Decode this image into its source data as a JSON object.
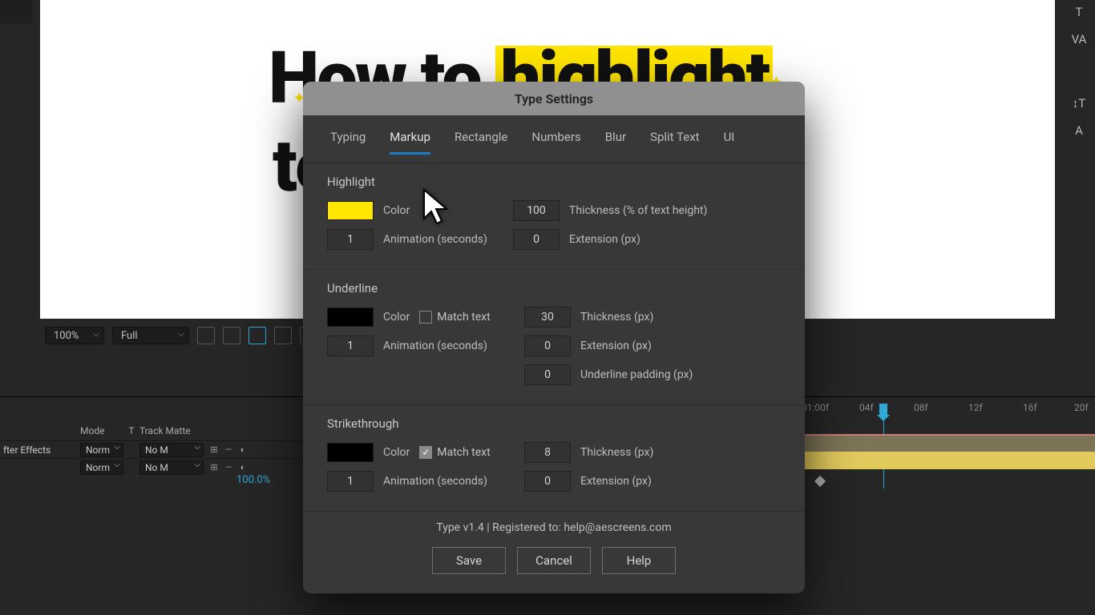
{
  "viewer": {
    "line1_a": "How to ",
    "line1_b": "highlight",
    "line2": "te",
    "zoom": "100%",
    "resolution": "Full"
  },
  "right_panel": {
    "char": "T",
    "vmetrics": "VA",
    "wrap": "↕T",
    "align": "A"
  },
  "layer_panel": {
    "row_label": "fter Effects",
    "mode_header": "Mode",
    "t_header": "T",
    "trackmatte_header": "Track Matte",
    "mode_value": "Norm",
    "track_value": "No M",
    "percent": "100.0%"
  },
  "timeline": {
    "t0": "01:00f",
    "t1": "04f",
    "t2": "08f",
    "t3": "12f",
    "t4": "16f",
    "t5": "20f"
  },
  "dialog": {
    "title": "Type Settings",
    "tabs": [
      "Typing",
      "Markup",
      "Rectangle",
      "Numbers",
      "Blur",
      "Split Text",
      "UI"
    ],
    "active_tab": 1,
    "highlight": {
      "title": "Highlight",
      "color_label": "Color",
      "color": "#ffe500",
      "anim_value": "1",
      "anim_label": "Animation (seconds)",
      "thickness_value": "100",
      "thickness_label": "Thickness (% of text height)",
      "extension_value": "0",
      "extension_label": "Extension (px)"
    },
    "underline": {
      "title": "Underline",
      "color_label": "Color",
      "color": "#000000",
      "match_text": false,
      "match_label": "Match text",
      "anim_value": "1",
      "anim_label": "Animation (seconds)",
      "thickness_value": "30",
      "thickness_label": "Thickness (px)",
      "extension_value": "0",
      "extension_label": "Extension (px)",
      "padding_value": "0",
      "padding_label": "Underline padding (px)"
    },
    "strike": {
      "title": "Strikethrough",
      "color_label": "Color",
      "color": "#000000",
      "match_text": true,
      "match_label": "Match text",
      "anim_value": "1",
      "anim_label": "Animation (seconds)",
      "thickness_value": "8",
      "thickness_label": "Thickness (px)",
      "extension_value": "0",
      "extension_label": "Extension (px)"
    },
    "footer_info": "Type v1.4 |  Registered to: help@aescreens.com",
    "save": "Save",
    "cancel": "Cancel",
    "help": "Help"
  }
}
